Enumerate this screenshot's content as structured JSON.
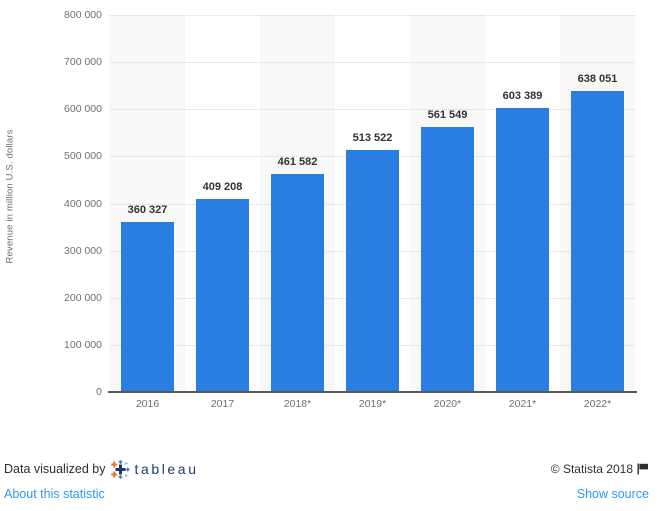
{
  "chart_data": {
    "type": "bar",
    "title": "",
    "subtitle": "",
    "xlabel": "",
    "ylabel": "Revenue in million U.S. dollars",
    "categories": [
      "2016",
      "2017",
      "2018*",
      "2019*",
      "2020*",
      "2021*",
      "2022*"
    ],
    "values": [
      360327,
      409208,
      461582,
      513522,
      561549,
      603389,
      638051
    ],
    "value_labels": [
      "360 327",
      "409 208",
      "461 582",
      "513 522",
      "561 549",
      "603 389",
      "638 051"
    ],
    "series": [
      {
        "name": "Revenue",
        "values": [
          360327,
          409208,
          461582,
          513522,
          561549,
          603389,
          638051
        ],
        "color": "#2a7de1"
      }
    ],
    "ylim": [
      0,
      800000
    ],
    "ytick_values": [
      0,
      100000,
      200000,
      300000,
      400000,
      500000,
      600000,
      700000,
      800000
    ],
    "ytick_labels": [
      "0",
      "100 000",
      "200 000",
      "300 000",
      "400 000",
      "500 000",
      "600 000",
      "700 000",
      "800 000"
    ],
    "grid": true,
    "grid_style": "dotted-horizontal",
    "legend": "none",
    "bar_color": "#2a7de1",
    "band_color": "#f8f8f8",
    "gridline_color": "#d6d6d6",
    "axis_color": "#595959"
  },
  "footer": {
    "tableau_credit_text": "Data visualized by",
    "tableau_wordmark": "tableau",
    "tableau_mark_icon": "tableau-plus-cluster-icon",
    "statista_copyright": "© Statista 2018",
    "flag_icon": "flag-icon",
    "about_link": "About this statistic",
    "show_source_link": "Show source",
    "link_color": "#2b9bf4"
  }
}
